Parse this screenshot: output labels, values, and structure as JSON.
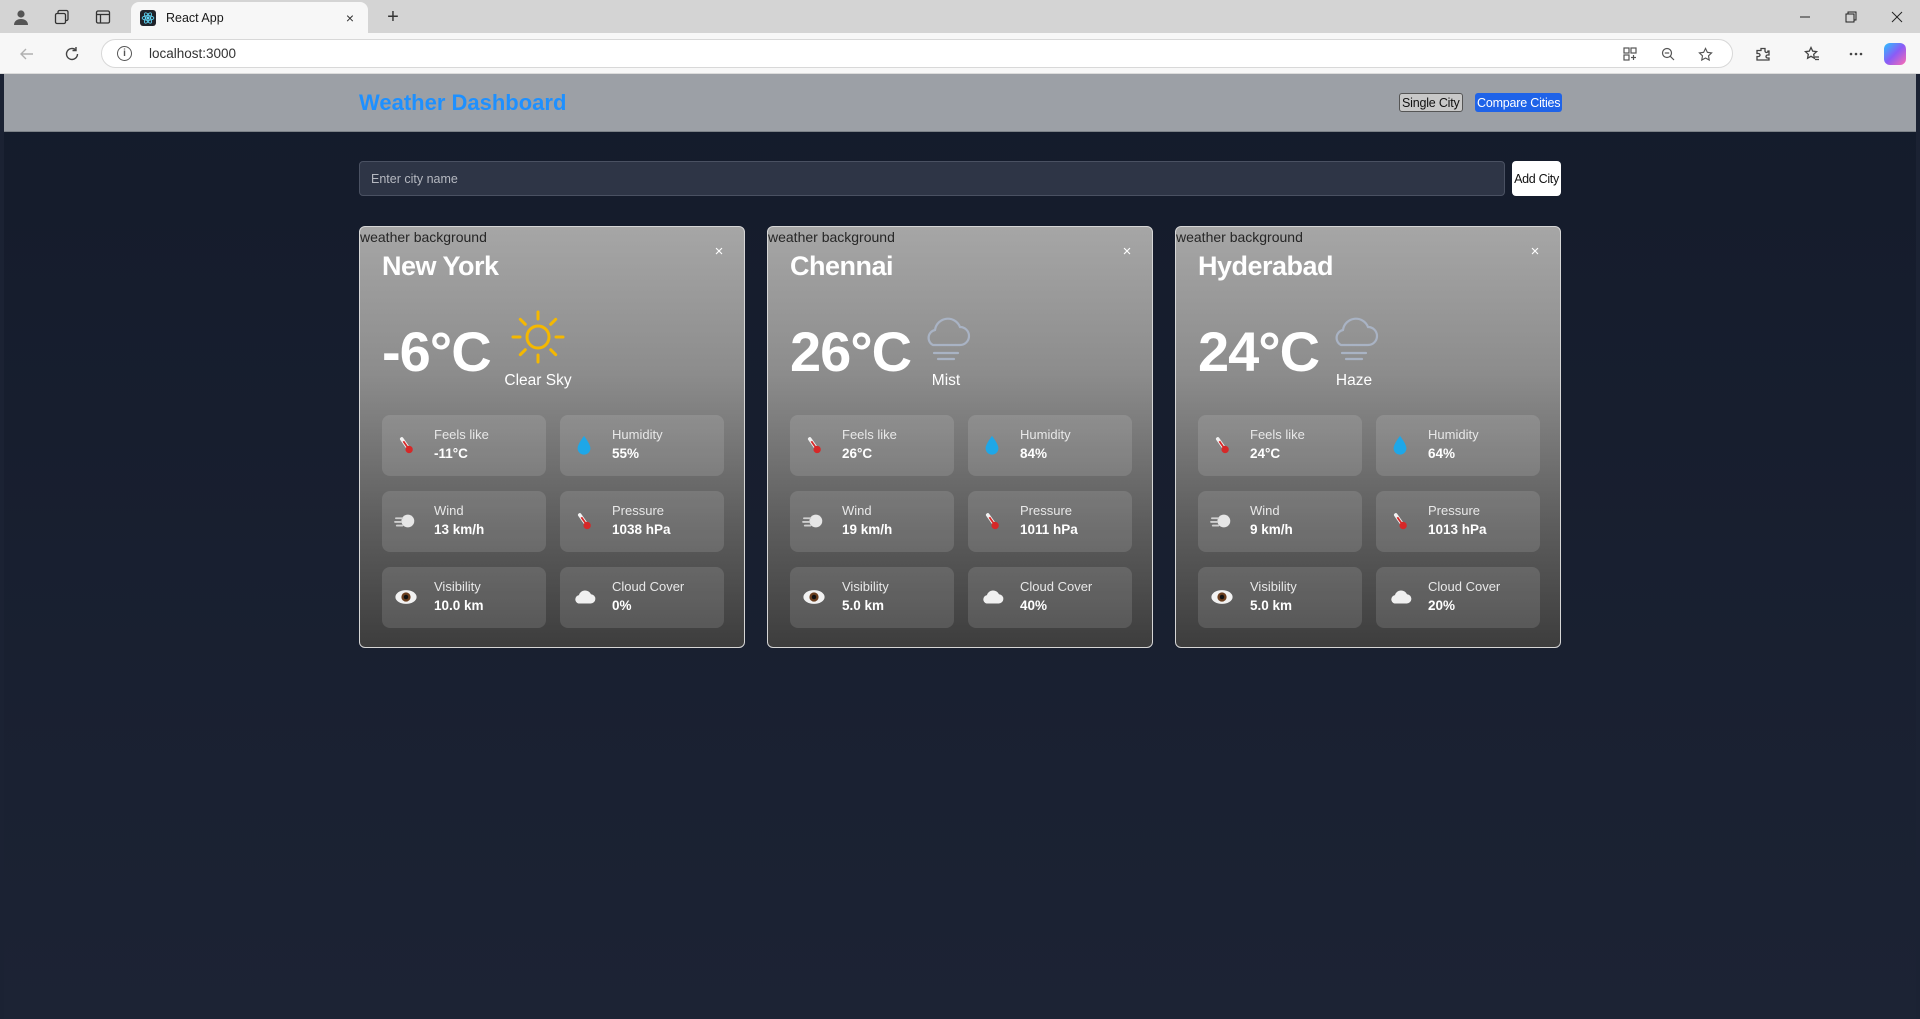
{
  "browser": {
    "tab_title": "React App",
    "url": "localhost:3000"
  },
  "app": {
    "title": "Weather Dashboard",
    "nav": {
      "single_city": "Single City",
      "compare_cities": "Compare Cities"
    },
    "search": {
      "placeholder": "Enter city name",
      "value": "",
      "add_button": "Add City"
    },
    "close_glyph": "×",
    "image_alt": "weather background",
    "stat_labels": {
      "feels_like": "Feels like",
      "humidity": "Humidity",
      "wind": "Wind",
      "pressure": "Pressure",
      "visibility": "Visibility",
      "cloud_cover": "Cloud Cover"
    },
    "cities": [
      {
        "name": "New York",
        "temp": "-6°C",
        "condition": "Clear Sky",
        "icon": "sun-icon",
        "feels_like": "-11°C",
        "humidity": "55%",
        "wind": "13 km/h",
        "pressure": "1038 hPa",
        "visibility": "10.0 km",
        "cloud_cover": "0%"
      },
      {
        "name": "Chennai",
        "temp": "26°C",
        "condition": "Mist",
        "icon": "cloud-fog-icon",
        "feels_like": "26°C",
        "humidity": "84%",
        "wind": "19 km/h",
        "pressure": "1011 hPa",
        "visibility": "5.0 km",
        "cloud_cover": "40%"
      },
      {
        "name": "Hyderabad",
        "temp": "24°C",
        "condition": "Haze",
        "icon": "cloud-fog-icon",
        "feels_like": "24°C",
        "humidity": "64%",
        "wind": "9 km/h",
        "pressure": "1013 hPa",
        "visibility": "5.0 km",
        "cloud_cover": "20%"
      }
    ]
  },
  "colors": {
    "accent_blue": "#1e90ff",
    "compare_button": "#1f63e8",
    "page_background": "#1b2233",
    "header_background": "#9ca0a6"
  }
}
